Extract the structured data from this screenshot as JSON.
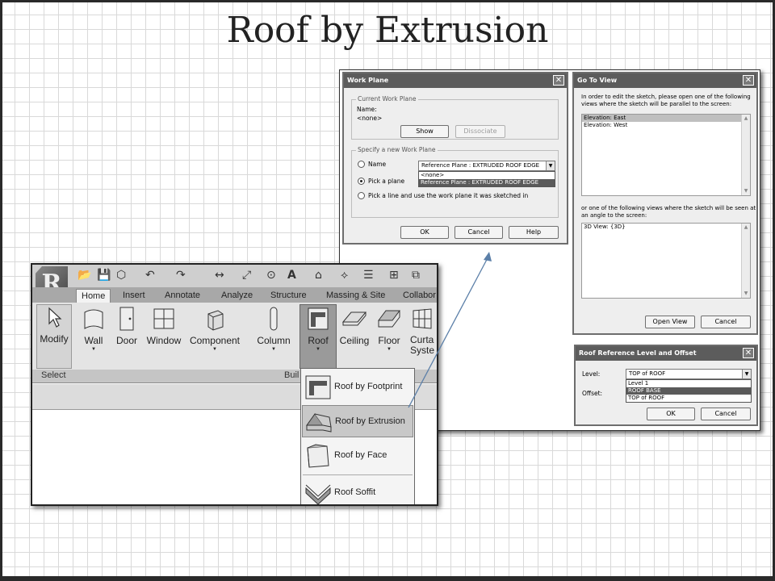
{
  "slide": {
    "title": "Roof by Extrusion"
  },
  "work_plane": {
    "title": "Work Plane",
    "current_group": "Current Work Plane",
    "name_label": "Name:",
    "name_value": "<none>",
    "show_btn": "Show",
    "dissociate_btn": "Dissociate",
    "specify_group": "Specify a new Work Plane",
    "opt_name": "Name",
    "combo_value": "Reference Plane : EXTRUDED ROOF EDGE",
    "dropdown": [
      "<none>",
      "Reference Plane : EXTRUDED ROOF EDGE"
    ],
    "opt_pick_plane": "Pick a plane",
    "opt_pick_line": "Pick a line and use the work plane it was sketched in",
    "ok": "OK",
    "cancel": "Cancel",
    "help": "Help"
  },
  "go_to_view": {
    "title": "Go To View",
    "intro": [
      "In order to edit the sketch, please open one of the following",
      "views where the sketch will be parallel to the screen:"
    ],
    "parallel_views": [
      "Elevation: East",
      "Elevation: West"
    ],
    "angle_text": [
      "or one of the following views where the sketch will be seen at",
      "an angle to the screen:"
    ],
    "angle_views": [
      "3D View: {3D}"
    ],
    "open_view": "Open View",
    "cancel": "Cancel"
  },
  "roof_ref": {
    "title": "Roof Reference Level and Offset",
    "level_label": "Level:",
    "level_value": "TOP of ROOF",
    "level_options": [
      "Level 1",
      "ROOF BASE",
      "TOP of ROOF"
    ],
    "offset_label": "Offset:",
    "ok": "OK",
    "cancel": "Cancel"
  },
  "revit": {
    "logo": "R",
    "logo_sub": "A",
    "tabs": [
      "Home",
      "Insert",
      "Annotate",
      "Analyze",
      "Structure",
      "Massing & Site",
      "Collabor"
    ],
    "ribbon_buttons": {
      "modify": "Modify",
      "wall": "Wall",
      "door": "Door",
      "window": "Window",
      "component": "Component",
      "column": "Column",
      "roof": "Roof",
      "ceiling": "Ceiling",
      "floor": "Floor",
      "curtain_1": "Curta",
      "curtain_2": "Syste"
    },
    "panel_labels": {
      "select": "Select",
      "build": "Buil"
    },
    "flyout": [
      "Roof by Footprint",
      "Roof by Extrusion",
      "Roof by Face",
      "Roof Soffit"
    ]
  }
}
